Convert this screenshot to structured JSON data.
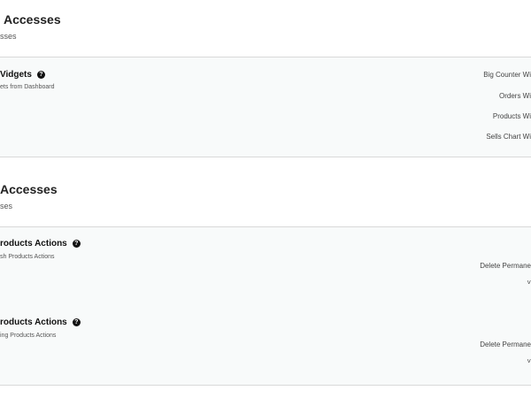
{
  "dashboard": {
    "title": "Accesses",
    "subtitle": "sses",
    "widgets": {
      "title": "Vidgets",
      "description": "ets from Dashboard",
      "options": [
        "Big Counter Wi",
        "Orders Wi",
        "Products Wi",
        "Sells Chart Wi"
      ]
    }
  },
  "products": {
    "title": "Accesses",
    "subtitle": "ses",
    "trash_actions": {
      "title": "roducts Actions",
      "description": "sh Products Actions",
      "option": "Delete Permane",
      "extra": "˅"
    },
    "pending_actions": {
      "title": "roducts Actions",
      "description": "ing Products Actions",
      "option": "Delete Permane",
      "extra": "˅"
    }
  }
}
